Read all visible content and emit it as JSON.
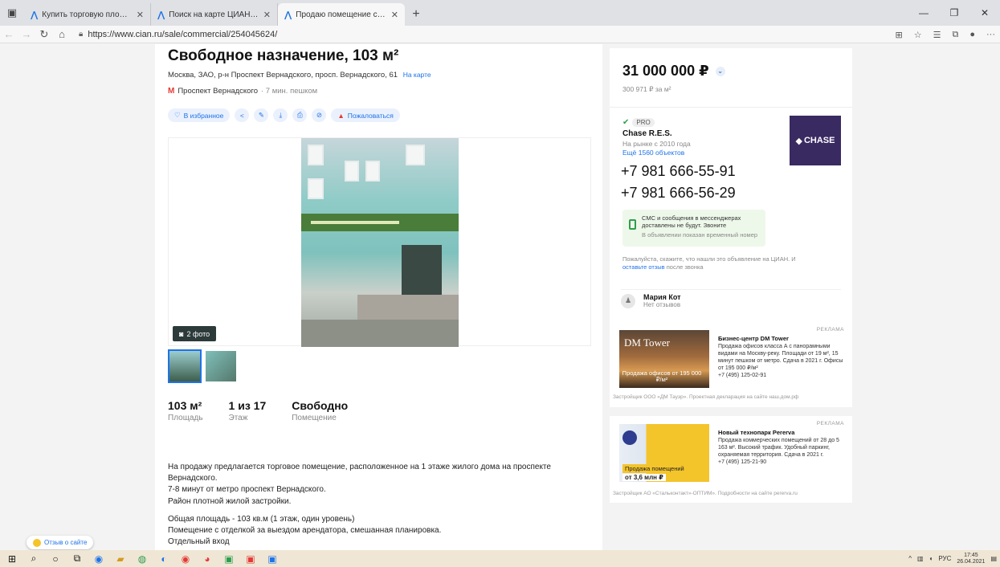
{
  "browser": {
    "tabs": [
      {
        "label": "Купить торговую площадь, пол",
        "active": false
      },
      {
        "label": "Поиск на карте ЦИАН в Моск",
        "active": false
      },
      {
        "label": "Продаю помещение свободно",
        "active": true
      }
    ],
    "new_tab": "+",
    "url": "https://www.cian.ru/sale/commercial/254045624/"
  },
  "listing": {
    "title": "Свободное назначение, 103 м²",
    "address": "Москва, ЗАО, р-н Проспект Вернадского, просп. Вернадского, 61",
    "map_link": "На карте",
    "metro": "Проспект Вернадского",
    "walk": "· 7 мин. пешком",
    "favorite": "В избранное",
    "complain": "Пожаловаться",
    "photo_count": "2 фото",
    "stats": [
      {
        "value": "103 м²",
        "label": "Площадь"
      },
      {
        "value": "1 из 17",
        "label": "Этаж"
      },
      {
        "value": "Свободно",
        "label": "Помещение"
      }
    ],
    "description": [
      "На продажу предлагается торговое помещение, расположенное на 1 этаже жилого дома на проспекте Вернадского.",
      "7-8 минут от метро проспект Вернадского.",
      "Район плотной жилой застройки.",
      "Общая площадь - 103 кв.м (1 этаж, один уровень)",
      "Помещение с отделкой за выездом арендатора, смешанная планировка.",
      "Отдельный вход"
    ]
  },
  "sidebar": {
    "price": "31 000 000 ₽",
    "price_per_m2": "300 971 ₽ за м²",
    "pro": "PRO",
    "agency": "Chase R.E.S.",
    "since": "На рынке с 2010 года",
    "more": "Ещё 1560 объектов",
    "logo": "CHASE",
    "phones": [
      "+7 981 666-55-91",
      "+7 981 666-56-29"
    ],
    "sms_line1": "СМС и сообщения в мессенджерах",
    "sms_line2": "доставлены не будут. Звоните",
    "sms_note": "В объявлении показан временный номер",
    "please_text": "Пожалуйста, скажите, что нашли это объявление на ЦИАН. И",
    "please_link": "оставьте отзыв",
    "please_tail": "после звонка",
    "agent_name": "Мария Кот",
    "agent_reviews": "Нет отзывов"
  },
  "ads": [
    {
      "label": "РЕКЛАМА",
      "img_title": "DM Tower",
      "img_caption": "Продажа офисов от 195 000 ₽/м²",
      "title": "Бизнес-центр DM Tower",
      "text": "Продажа офисов класса А с панорамными видами на Москву-реку. Площади от 19 м², 15 минут пешком от метро. Сдача в 2021 г. Офисы от 195 000 ₽/м²",
      "phone": "+7 (495) 125-02-91",
      "footer": "Застройщик ООО «ДМ Тауэр». Проектная декларация на сайте наш.дом.рф"
    },
    {
      "label": "РЕКЛАМА",
      "img_badge": "Продажа помещений",
      "img_price": "от 3,6 млн ₽",
      "title": "Новый технопарк Pererva",
      "text": "Продажа коммерческих помещений от 28 до 5 163 м². Высокий трафик. Удобный паркинг, охраняемая территория. Сдача в 2021 г.",
      "phone": "+7 (495) 125-21-90",
      "footer": "Застройщик АО «Стальконтакт»-ОПТИМ». Подробности на сайте pererva.ru"
    }
  ],
  "review_widget": "Отзыв о сайте",
  "taskbar": {
    "lang": "РУС",
    "time": "17:45",
    "date": "26.04.2021"
  },
  "colors": {
    "accent": "#1e73e8",
    "metro": "#e53935",
    "logo_bg": "#3a2a62",
    "pro_check": "#2e9e4d"
  }
}
